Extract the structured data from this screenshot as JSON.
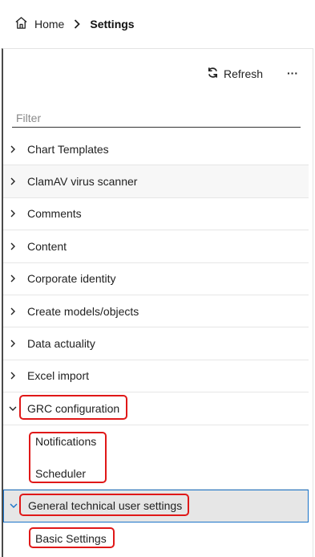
{
  "breadcrumb": {
    "home_label": "Home",
    "current_label": "Settings"
  },
  "toolbar": {
    "refresh_label": "Refresh",
    "more_label": "···"
  },
  "filter": {
    "placeholder": "Filter",
    "value": ""
  },
  "tree": {
    "items": [
      {
        "label": "Chart Templates",
        "expanded": false
      },
      {
        "label": "ClamAV virus scanner",
        "expanded": false
      },
      {
        "label": "Comments",
        "expanded": false
      },
      {
        "label": "Content",
        "expanded": false
      },
      {
        "label": "Corporate identity",
        "expanded": false
      },
      {
        "label": "Create models/objects",
        "expanded": false
      },
      {
        "label": "Data actuality",
        "expanded": false
      },
      {
        "label": "Excel import",
        "expanded": false
      },
      {
        "label": "GRC configuration",
        "expanded": true,
        "children": [
          "Notifications",
          "Scheduler"
        ]
      },
      {
        "label": "General technical user settings",
        "expanded": true,
        "selected": true,
        "children": [
          "Basic Settings"
        ]
      }
    ]
  },
  "colors": {
    "highlight": "#e01818",
    "selected_border": "#1a73c8",
    "selected_bg": "#e6e6e6"
  }
}
